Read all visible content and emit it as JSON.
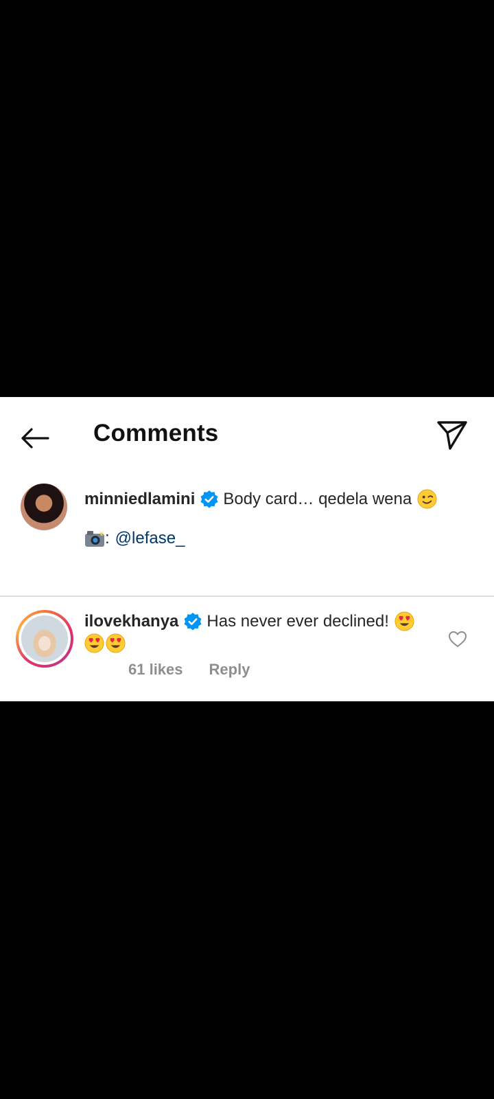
{
  "header": {
    "title": "Comments"
  },
  "caption": {
    "username": "minniedlamini",
    "text": "Body card… qedela wena",
    "credit_sep": ":",
    "mention": "@lefase_"
  },
  "comment": {
    "username": "ilovekhanya",
    "text": "Has never ever declined!",
    "likes": "61 likes",
    "reply_label": "Reply"
  },
  "colors": {
    "verified": "#0095f6",
    "mention": "#00376b",
    "meta": "#8e8e8e",
    "divider": "#dbdbdb"
  },
  "icons": [
    "back-arrow-icon",
    "send-icon",
    "verified-badge-icon",
    "wink-emoji-icon",
    "camera-flash-emoji-icon",
    "heart-eyes-emoji-icon",
    "heart-outline-icon"
  ]
}
